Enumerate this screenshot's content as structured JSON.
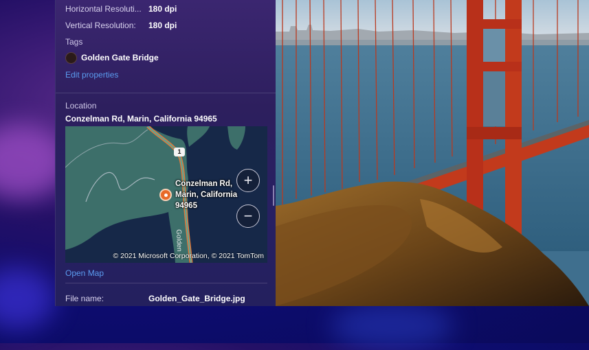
{
  "properties": {
    "horizontal_resolution": {
      "label": "Horizontal Resoluti...",
      "value": "180 dpi"
    },
    "vertical_resolution": {
      "label": "Vertical Resolution:",
      "value": "180 dpi"
    },
    "tags_label": "Tags",
    "tags": [
      {
        "name": "Golden Gate Bridge",
        "color": "#2a1a1a"
      }
    ],
    "edit_properties_link": "Edit properties",
    "location_label": "Location",
    "location_value": "Conzelman Rd, Marin, California 94965",
    "map": {
      "pin_label": "Conzelman Rd, Marin, California 94965",
      "route_shield": "1",
      "road_label": "Golden",
      "zoom_in": "+",
      "zoom_out": "−",
      "copyright": "© 2021 Microsoft Corporation, © 2021 TomTom"
    },
    "open_map_link": "Open Map",
    "file_name": {
      "label": "File name:",
      "value": "Golden_Gate_Bridge.jpg"
    }
  },
  "colors": {
    "link": "#5b9cf0",
    "panel_bg": "#2d1f5e",
    "map_pin": "#e86a28",
    "bridge": "#c0341c"
  }
}
